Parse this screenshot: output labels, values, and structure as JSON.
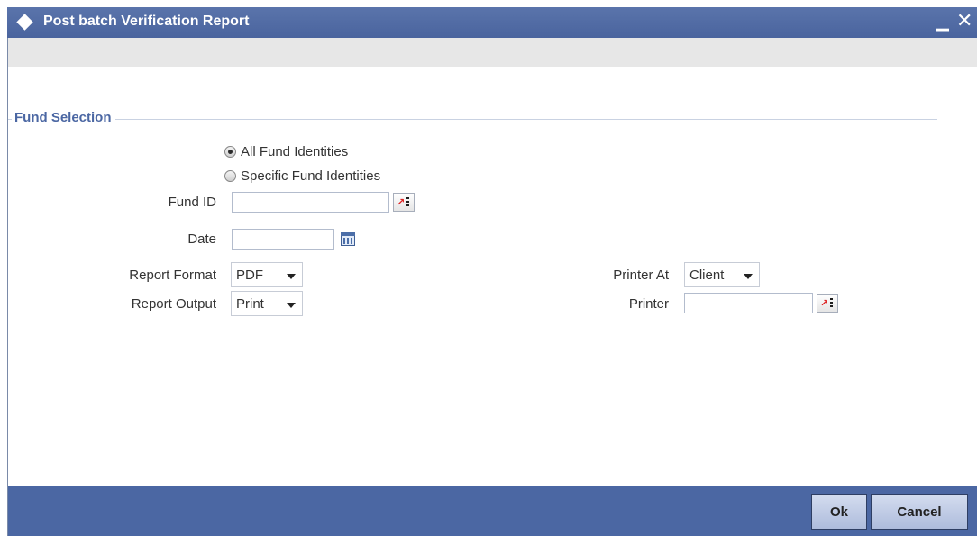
{
  "window": {
    "title": "Post batch Verification Report",
    "minimize_glyph": "▁",
    "close_glyph": "✕"
  },
  "section": {
    "title": "Fund Selection"
  },
  "radios": [
    {
      "label": "All Fund Identities",
      "checked": true
    },
    {
      "label": "Specific Fund Identities",
      "checked": false
    }
  ],
  "form": {
    "fund_id_label": "Fund ID",
    "fund_id_value": "",
    "date_label": "Date",
    "date_value": "",
    "report_format_label": "Report Format",
    "report_format_value": "PDF",
    "report_output_label": "Report Output",
    "report_output_value": "Print",
    "printer_at_label": "Printer At",
    "printer_at_value": "Client",
    "printer_label": "Printer",
    "printer_value": ""
  },
  "buttons": {
    "ok": "Ok",
    "cancel": "Cancel"
  },
  "icons": {
    "title": "diamond-icon",
    "lookup": "lookup-icon",
    "calendar": "calendar-icon"
  },
  "colors": {
    "titlebar": "#4f69a2",
    "footer": "#4b67a3",
    "section_title": "#4b67a3"
  }
}
